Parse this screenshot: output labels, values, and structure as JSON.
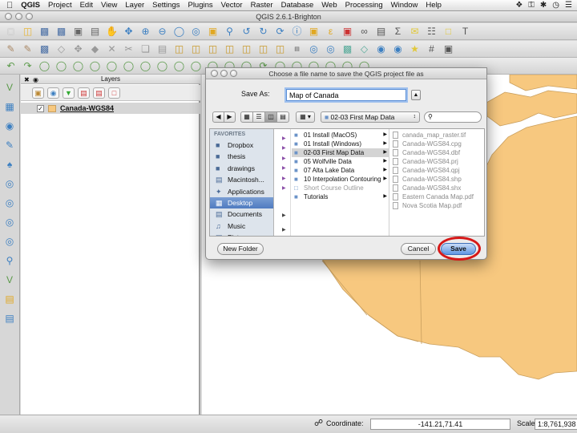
{
  "menubar": {
    "app_name": "QGIS",
    "items": [
      "Project",
      "Edit",
      "View",
      "Layer",
      "Settings",
      "Plugins",
      "Vector",
      "Raster",
      "Database",
      "Web",
      "Processing",
      "Window",
      "Help"
    ]
  },
  "window": {
    "title": "QGIS 2.6.1-Brighton"
  },
  "layers_panel": {
    "title": "Layers",
    "layer": {
      "name": "Canada-WGS84",
      "checked": true
    }
  },
  "statusbar": {
    "coordinate_label": "Coordinate:",
    "coordinate_value": "-141.21,71.41",
    "scale_label": "Scale",
    "scale_value": "1:8,761,938"
  },
  "dialog": {
    "title": "Choose a file name to save the QGIS project file as",
    "save_as_label": "Save As:",
    "save_as_value": "Map of Canada",
    "current_folder": "02-03 First Map Data",
    "favorites_header": "FAVORITES",
    "favorites": [
      {
        "label": "Dropbox",
        "icon": "folder-icon",
        "selected": false
      },
      {
        "label": "thesis",
        "icon": "folder-icon",
        "selected": false
      },
      {
        "label": "drawings",
        "icon": "folder-icon",
        "selected": false
      },
      {
        "label": "Macintosh...",
        "icon": "hard-drive-icon",
        "selected": false
      },
      {
        "label": "Applications",
        "icon": "applications-icon",
        "selected": false
      },
      {
        "label": "Desktop",
        "icon": "desktop-icon",
        "selected": true
      },
      {
        "label": "Documents",
        "icon": "documents-icon",
        "selected": false
      },
      {
        "label": "Music",
        "icon": "music-icon",
        "selected": false
      },
      {
        "label": "Pictures",
        "icon": "pictures-icon",
        "selected": false
      }
    ],
    "folders": [
      {
        "label": "01 Install (MacOS)",
        "selected": false,
        "dim": false
      },
      {
        "label": "01 Install (Windows)",
        "selected": false,
        "dim": false
      },
      {
        "label": "02-03 First Map Data",
        "selected": true,
        "dim": false
      },
      {
        "label": "05 Wolfville Data",
        "selected": false,
        "dim": false
      },
      {
        "label": "07 Alta Lake Data",
        "selected": false,
        "dim": false
      },
      {
        "label": "10 Interpolation Contouring",
        "selected": false,
        "dim": false
      },
      {
        "label": "Short Course Outline",
        "selected": false,
        "dim": true
      },
      {
        "label": "Tutorials",
        "selected": false,
        "dim": false
      }
    ],
    "files": [
      "canada_map_raster.tif",
      "Canada-WGS84.cpg",
      "Canada-WGS84.dbf",
      "Canada-WGS84.prj",
      "Canada-WGS84.qpj",
      "Canada-WGS84.shp",
      "Canada-WGS84.shx",
      "Eastern Canada Map.pdf",
      "Nova Scotia Map.pdf"
    ],
    "new_folder_label": "New Folder",
    "cancel_label": "Cancel",
    "save_label": "Save"
  },
  "colors": {
    "map_fill": "#f7c87f",
    "map_stroke": "#c99f5e",
    "highlight": "#d61818"
  }
}
